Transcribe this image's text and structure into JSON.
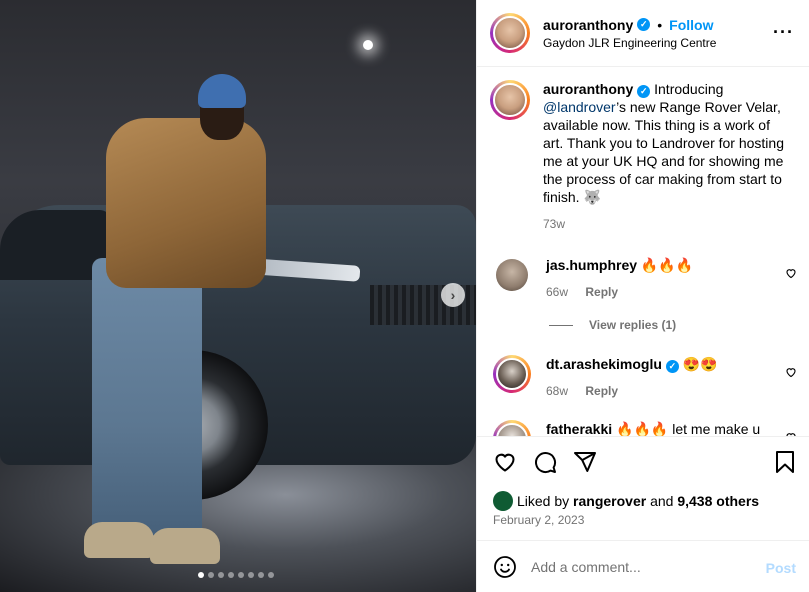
{
  "post": {
    "username": "auroranthony",
    "location": "Gaydon JLR Engineering Centre",
    "follow_label": "Follow",
    "separator": "•",
    "more_icon": "more-horizontal-icon",
    "verified_symbol": "✓"
  },
  "media": {
    "next_symbol": "›",
    "carousel": {
      "total": 8,
      "current": 1
    }
  },
  "caption": {
    "username": "auroranthony",
    "intro": "Introducing",
    "mention": "@landrover",
    "text": "’s new Range Rover Velar, available now. This thing is a work of art. Thank you to Landrover for hosting me at your UK HQ and for showing me the process of car making from start to finish. 🐺",
    "time": "73w"
  },
  "comments": [
    {
      "username": "jas.humphrey",
      "text": "🔥🔥🔥",
      "time": "66w",
      "reply_label": "Reply",
      "verified": false
    },
    {
      "username": "dt.arashekimoglu",
      "text": "😍😍",
      "time": "68w",
      "reply_label": "Reply",
      "verified": true
    },
    {
      "username": "fatherakki",
      "text": "🔥🔥🔥 let me make u",
      "time": "",
      "reply_label": "",
      "verified": false
    }
  ],
  "view_replies": "View replies (1)",
  "likes": {
    "prefix": "Liked by",
    "user": "rangerover",
    "and": "and",
    "count": "9,438 others"
  },
  "date": "February 2, 2023",
  "comment_box": {
    "placeholder": "Add a comment...",
    "post_label": "Post"
  },
  "colors": {
    "link": "#0095f6",
    "mention": "#00376b",
    "muted": "#737373",
    "post_disabled": "#b3dbff"
  }
}
